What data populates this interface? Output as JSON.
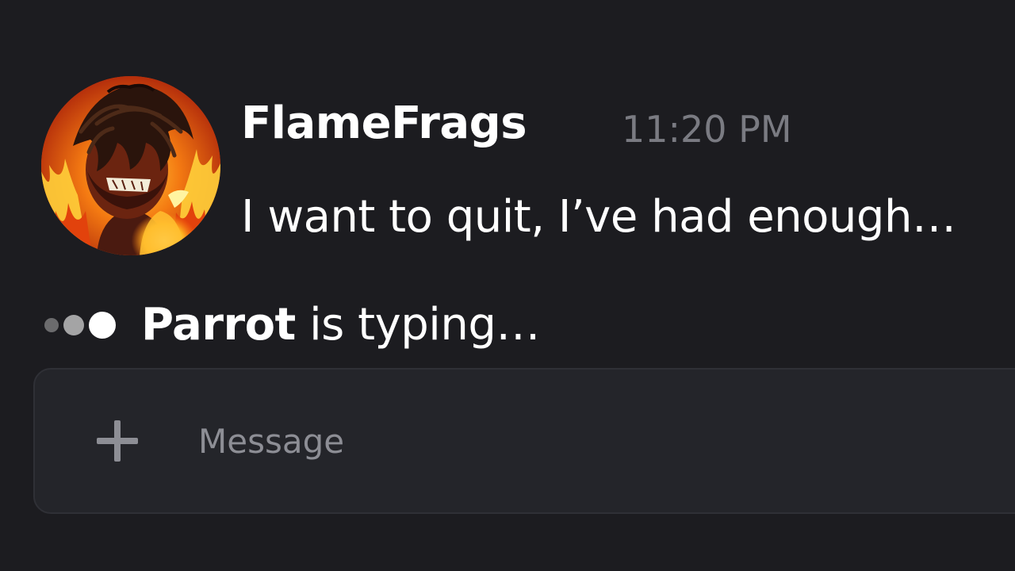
{
  "message": {
    "username": "FlameFrags",
    "timestamp": "11:20 PM",
    "text": "I want to quit, I’ve had enough…",
    "avatar_icon": "flaming-character-avatar"
  },
  "typing_indicator": {
    "user": "Parrot",
    "suffix": " is typing…",
    "icon": "typing-dots-icon"
  },
  "composer": {
    "placeholder": "Message",
    "value": "",
    "add_icon": "plus-icon"
  },
  "colors": {
    "background": "#1c1c20",
    "composer_background": "#24252a",
    "timestamp": "#7a7b82",
    "placeholder": "#8d8e95",
    "text": "#ffffff"
  }
}
